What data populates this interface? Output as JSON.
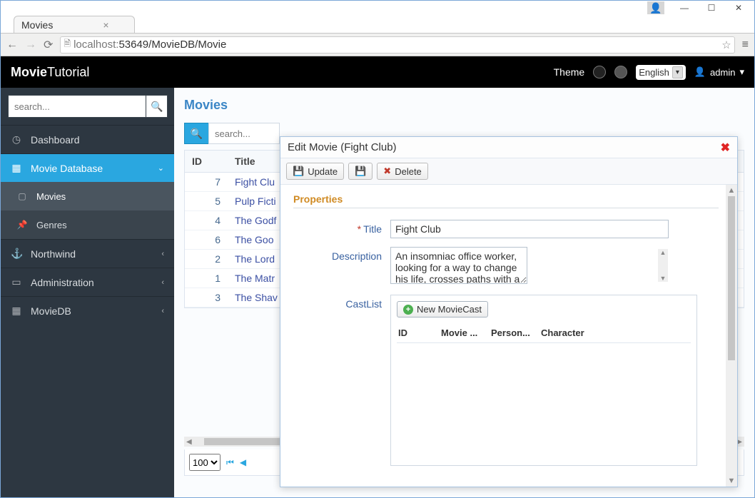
{
  "os": {
    "user_icon": "👤",
    "minimize": "—",
    "maximize": "☐",
    "close": "✕"
  },
  "browser": {
    "tab_title": "Movies",
    "url_host": "localhost:",
    "url_rest": "53649/MovieDB/Movie"
  },
  "header": {
    "app_title_bold": "Movie",
    "app_title_light": "Tutorial",
    "theme_label": "Theme",
    "language": "English",
    "user": "admin"
  },
  "sidebar": {
    "search_placeholder": "search...",
    "items": [
      {
        "icon": "◷",
        "label": "Dashboard",
        "expand": ""
      },
      {
        "icon": "▦",
        "label": "Movie Database",
        "expand": "⌄",
        "active": true,
        "children": [
          {
            "icon": "▢",
            "label": "Movies",
            "selected": true
          },
          {
            "icon": "📌",
            "label": "Genres",
            "selected": false
          }
        ]
      },
      {
        "icon": "⚓",
        "label": "Northwind",
        "expand": "‹"
      },
      {
        "icon": "▭",
        "label": "Administration",
        "expand": "‹"
      },
      {
        "icon": "▦",
        "label": "MovieDB",
        "expand": "‹"
      }
    ]
  },
  "content": {
    "page_title": "Movies",
    "search_placeholder": "search...",
    "columns": {
      "id": "ID",
      "title": "Title"
    },
    "rows": [
      {
        "id": "7",
        "title": "Fight Clu"
      },
      {
        "id": "5",
        "title": "Pulp Ficti"
      },
      {
        "id": "4",
        "title": "The Godf"
      },
      {
        "id": "6",
        "title": "The Goo"
      },
      {
        "id": "2",
        "title": "The Lord"
      },
      {
        "id": "1",
        "title": "The Matr"
      },
      {
        "id": "3",
        "title": "The Shav"
      }
    ],
    "page_size": "100"
  },
  "dialog": {
    "title": "Edit Movie (Fight Club)",
    "buttons": {
      "update": "Update",
      "delete": "Delete",
      "newcast": "New MovieCast"
    },
    "section": "Properties",
    "labels": {
      "title": "Title",
      "description": "Description",
      "castlist": "CastList"
    },
    "values": {
      "title": "Fight Club",
      "description": "An insomniac office worker, looking for a way to change his life, crosses paths with a devil-may-care soap maker, forming an underground fight club that evolves into something much,"
    },
    "cast_columns": {
      "id": "ID",
      "movie": "Movie ...",
      "person": "Person...",
      "character": "Character"
    }
  }
}
